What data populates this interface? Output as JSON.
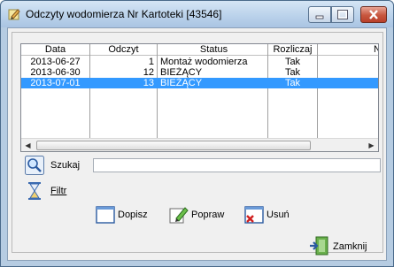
{
  "window": {
    "title": "Odczyty wodomierza Nr Kartoteki [43546]",
    "accent": "#3399ff"
  },
  "grid": {
    "columns": [
      "Data",
      "Odczyt",
      "Status",
      "Rozliczaj",
      "N"
    ],
    "rows": [
      {
        "data": "2013-06-27",
        "odczyt": "1",
        "status": "Montaż wodomierza",
        "rozliczaj": "Tak",
        "selected": false
      },
      {
        "data": "2013-06-30",
        "odczyt": "12",
        "status": "BIEŻĄCY",
        "rozliczaj": "Tak",
        "selected": false
      },
      {
        "data": "2013-07-01",
        "odczyt": "13",
        "status": "BIEŻĄCY",
        "rozliczaj": "Tak",
        "selected": true
      }
    ]
  },
  "search": {
    "label": "Szukaj",
    "value": "",
    "icon": "magnifier-icon"
  },
  "filter": {
    "label": "Filtr",
    "icon": "hourglass-icon"
  },
  "actions": {
    "add_label": "Dopisz",
    "edit_label": "Popraw",
    "delete_label": "Usuń"
  },
  "footer": {
    "close_label": "Zamknij"
  }
}
